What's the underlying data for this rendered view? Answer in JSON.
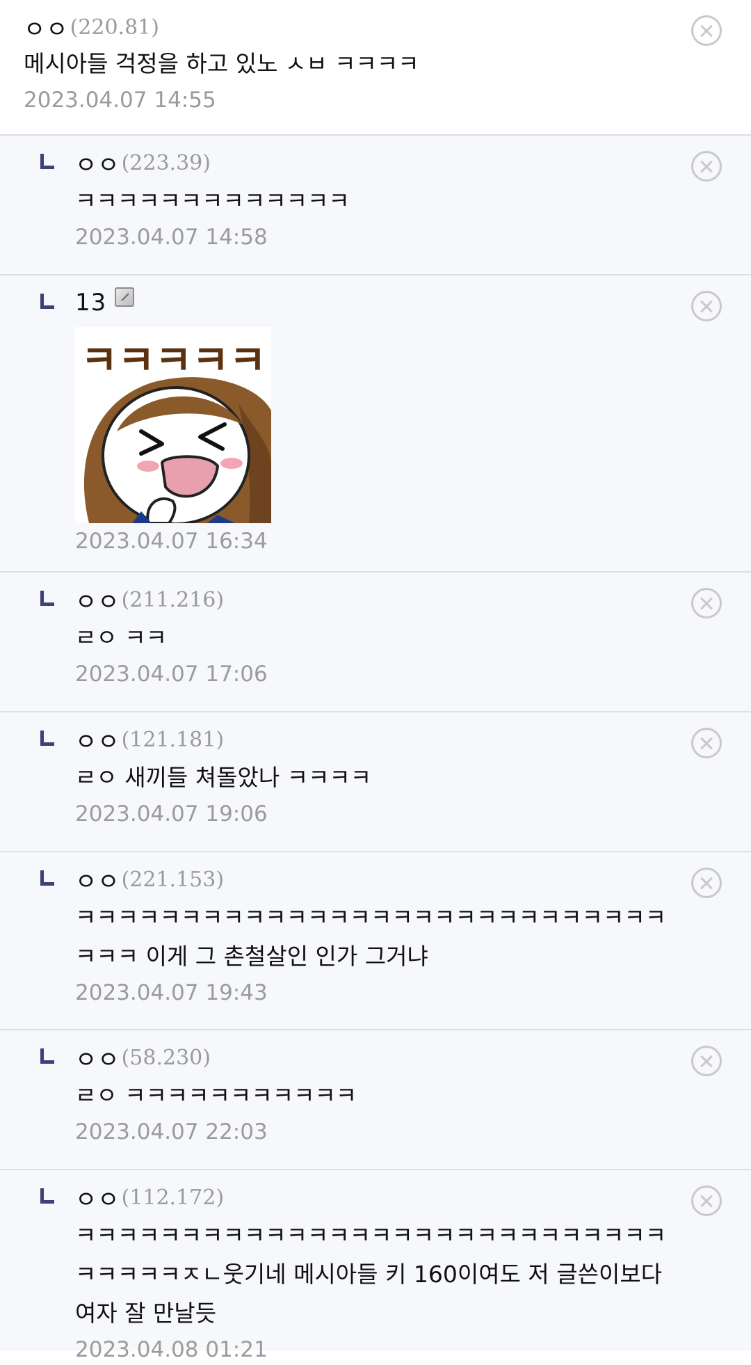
{
  "comments": [
    {
      "nickname": "ㅇㅇ",
      "ip": "(220.81)",
      "text": "메시아들 걱정을 하고 있노 ㅅㅂ ㅋㅋㅋㅋ",
      "date": "2023.04.07 14:55",
      "is_reply": false
    },
    {
      "nickname": "ㅇㅇ",
      "ip": "(223.39)",
      "text": "ㅋㅋㅋㅋㅋㅋㅋㅋㅋㅋㅋㅋㅋ",
      "date": "2023.04.07 14:58",
      "is_reply": true
    },
    {
      "nickname": "13",
      "ip": "",
      "text": "ㅋㅋㅋㅋㅋ",
      "date": "2023.04.07 16:34",
      "is_reply": true,
      "has_dccon": true,
      "member_badge_icon": "member-badge-icon"
    },
    {
      "nickname": "ㅇㅇ",
      "ip": "(211.216)",
      "text": "ㄹㅇ ㅋㅋ",
      "date": "2023.04.07 17:06",
      "is_reply": true
    },
    {
      "nickname": "ㅇㅇ",
      "ip": "(121.181)",
      "text": "ㄹㅇ 새끼들 쳐돌았나 ㅋㅋㅋㅋ",
      "date": "2023.04.07 19:06",
      "is_reply": true
    },
    {
      "nickname": "ㅇㅇ",
      "ip": "(221.153)",
      "text": "ㅋㅋㅋㅋㅋㅋㅋㅋㅋㅋㅋㅋㅋㅋㅋㅋㅋㅋㅋㅋㅋㅋㅋㅋㅋㅋㅋㅋㅋㅋㅋ 이게 그 촌철살인 인가 그거냐",
      "date": "2023.04.07 19:43",
      "is_reply": true
    },
    {
      "nickname": "ㅇㅇ",
      "ip": "(58.230)",
      "text": "ㄹㅇ ㅋㅋㅋㅋㅋㅋㅋㅋㅋㅋㅋ",
      "date": "2023.04.07 22:03",
      "is_reply": true
    },
    {
      "nickname": "ㅇㅇ",
      "ip": "(112.172)",
      "text": "ㅋㅋㅋㅋㅋㅋㅋㅋㅋㅋㅋㅋㅋㅋㅋㅋㅋㅋㅋㅋㅋㅋㅋㅋㅋㅋㅋㅋㅋㅋㅋㅋㅋㅈㄴ웃기네 메시아들 키 160이여도 저 글쓴이보다 여자 잘 만날듯",
      "date": "2023.04.08 01:21",
      "is_reply": true
    }
  ],
  "icons": {
    "reply": "reply-arrow-icon",
    "delete": "close-circle-icon",
    "member": "member-badge-icon"
  },
  "colors": {
    "reply_background": "#f7f8fc",
    "reply_marker": "#3c4278",
    "divider": "#dcdfe6",
    "meta_gray": "#9b9b9b"
  }
}
